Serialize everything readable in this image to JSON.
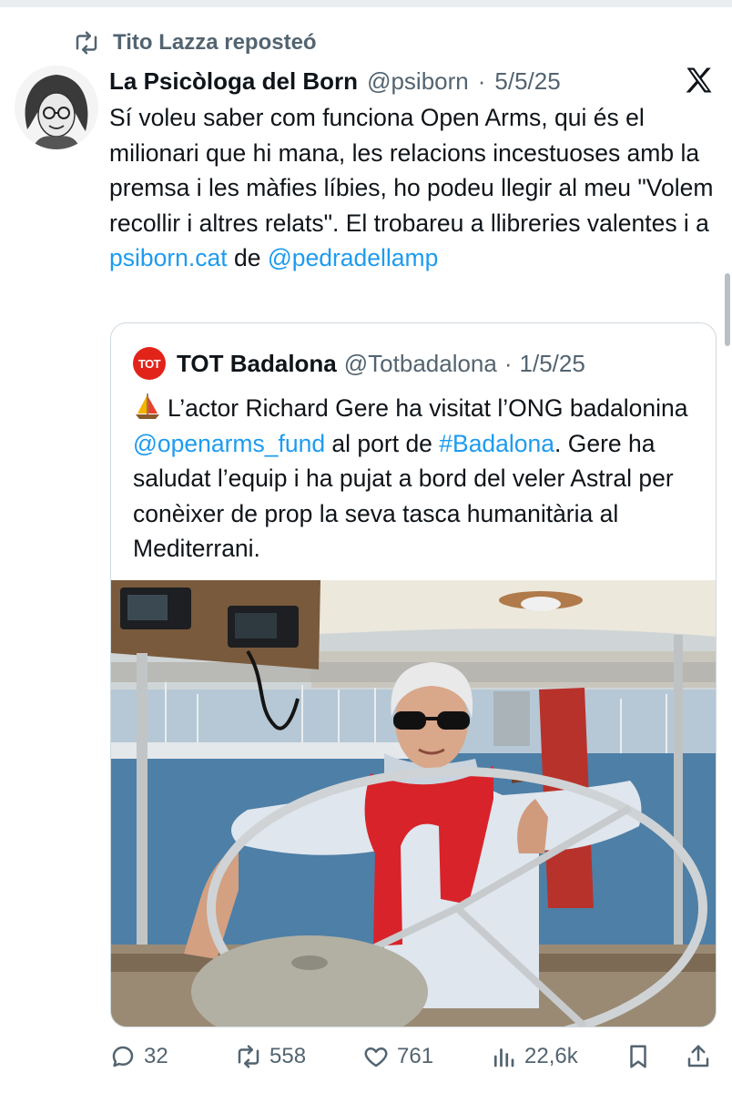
{
  "repost": {
    "text": "Tito Lazza reposteó",
    "icon": "repost-icon"
  },
  "tweet": {
    "author_name": "La Psicòloga del Born",
    "author_handle": "@psiborn",
    "separator": "·",
    "date": "5/5/25",
    "text_parts": {
      "t1": "Sí voleu saber com funciona Open Arms, qui és el milionari que hi mana, les relacions incestuoses amb la premsa i les màfies líbies, ho podeu llegir al meu \"Volem recollir i altres relats\". El trobareu a llibreries valentes i a ",
      "link1": "psiborn.cat",
      "t2": " de ",
      "link2": "@pedradellamp"
    }
  },
  "quote": {
    "avatar_text": "TOT",
    "author_name": "TOT Badalona",
    "author_handle": "@Totbadalona",
    "separator": "·",
    "date": "1/5/25",
    "text_parts": {
      "t1": "L’actor Richard Gere ha visitat l’ONG badalonina ",
      "link1": "@openarms_fund",
      "t2": " al port de ",
      "link2": "#Badalona",
      "t3": ". Gere ha saludat l’equip i ha pujat a bord del veler Astral per conèixer de prop la seva tasca humanitària al Mediterrani."
    },
    "media": "photo-man-at-sailboat-wheel"
  },
  "actions": {
    "replies": "32",
    "reposts": "558",
    "likes": "761",
    "views": "22,6k"
  },
  "colors": {
    "link": "#1d9bf0",
    "muted": "#536471",
    "text": "#0f1419",
    "border": "#cfd9de"
  }
}
